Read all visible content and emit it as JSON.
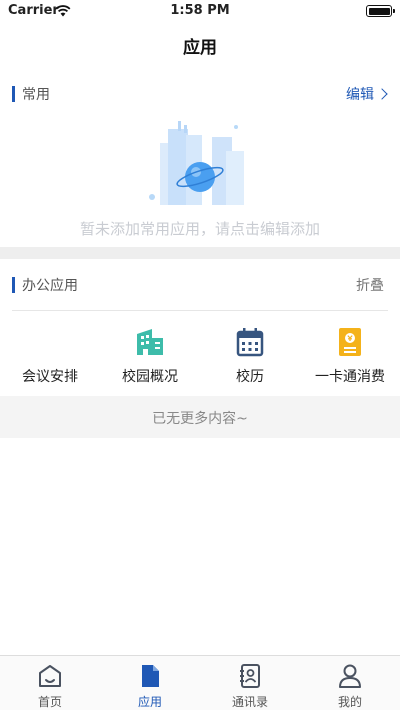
{
  "status_bar": {
    "carrier": "Carrier",
    "time": "1:58 PM"
  },
  "nav": {
    "title": "应用"
  },
  "favorites": {
    "title": "常用",
    "edit_label": "编辑",
    "empty_text": "暂未添加常用应用，请点击编辑添加"
  },
  "office": {
    "title": "办公应用",
    "collapse_label": "折叠",
    "apps": [
      {
        "label": "会议安排",
        "icon": "meeting-icon"
      },
      {
        "label": "校园概况",
        "icon": "building-icon",
        "color": "#3dbcaa"
      },
      {
        "label": "校历",
        "icon": "calendar-icon",
        "color": "#37557f"
      },
      {
        "label": "一卡通消费",
        "icon": "card-icon",
        "color": "#f4b21a"
      }
    ]
  },
  "footer": {
    "no_more_text": "已无更多内容~"
  },
  "tabs": [
    {
      "label": "首页",
      "icon": "home-icon",
      "active": false
    },
    {
      "label": "应用",
      "icon": "document-icon",
      "active": true
    },
    {
      "label": "通讯录",
      "icon": "contacts-icon",
      "active": false
    },
    {
      "label": "我的",
      "icon": "profile-icon",
      "active": false
    }
  ],
  "colors": {
    "accent": "#1f58b5",
    "band": "#eeeeee"
  }
}
